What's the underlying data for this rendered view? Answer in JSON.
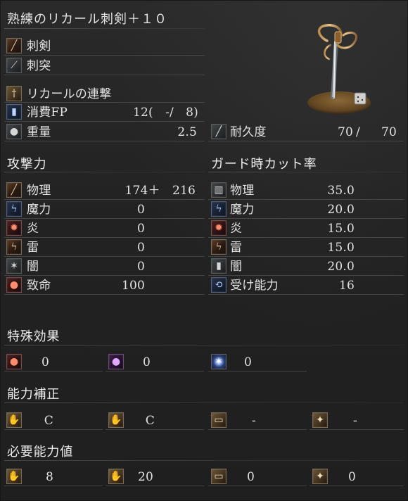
{
  "weapon": {
    "name": "熟練のリカール刺剣＋１０",
    "image_icon": "rapier-with-pedestal-icon",
    "attack_types": [
      {
        "icon": "slash-type-icon",
        "label": "刺剣"
      },
      {
        "icon": "thrust-type-icon",
        "label": "刺突"
      }
    ],
    "skill": {
      "icon": "skill-icon",
      "label": "リカールの連撃"
    },
    "fp": {
      "icon": "fp-icon",
      "label": "消費FP",
      "value": "12(　-/　8)"
    },
    "weight": {
      "icon": "weight-icon",
      "label": "重量",
      "value": "2.5"
    },
    "durability": {
      "icon": "durability-icon",
      "label": "耐久度",
      "current": "70",
      "sep": "/",
      "max": "70"
    }
  },
  "attack_power": {
    "title": "攻撃力",
    "rows": [
      {
        "icon": "physical-attack-icon",
        "label": "物理",
        "value": "174＋　216"
      },
      {
        "icon": "magic-attack-icon",
        "label": "魔力",
        "value": "0"
      },
      {
        "icon": "fire-attack-icon",
        "label": "炎",
        "value": "0"
      },
      {
        "icon": "lightning-attack-icon",
        "label": "雷",
        "value": "0"
      },
      {
        "icon": "dark-attack-icon",
        "label": "闇",
        "value": "0"
      },
      {
        "icon": "critical-icon",
        "label": "致命",
        "value": "100"
      }
    ]
  },
  "guard": {
    "title": "ガード時カット率",
    "rows": [
      {
        "icon": "physical-guard-icon",
        "label": "物理",
        "value": "35.0"
      },
      {
        "icon": "magic-guard-icon",
        "label": "魔力",
        "value": "20.0"
      },
      {
        "icon": "fire-guard-icon",
        "label": "炎",
        "value": "15.0"
      },
      {
        "icon": "lightning-guard-icon",
        "label": "雷",
        "value": "15.0"
      },
      {
        "icon": "dark-guard-icon",
        "label": "闇",
        "value": "20.0"
      },
      {
        "icon": "stability-icon",
        "label": "受け能力",
        "value": "16"
      }
    ]
  },
  "special_effects": {
    "title": "特殊効果",
    "items": [
      {
        "icon": "bleed-effect-icon",
        "value": "0"
      },
      {
        "icon": "poison-effect-icon",
        "value": "0"
      },
      {
        "icon": "frost-effect-icon",
        "value": "0"
      }
    ]
  },
  "scaling": {
    "title": "能力補正",
    "items": [
      {
        "icon": "strength-scaling-icon",
        "value": "C"
      },
      {
        "icon": "dexterity-scaling-icon",
        "value": "C"
      },
      {
        "icon": "intelligence-scaling-icon",
        "value": "-"
      },
      {
        "icon": "faith-scaling-icon",
        "value": "-"
      }
    ]
  },
  "requirements": {
    "title": "必要能力値",
    "items": [
      {
        "icon": "strength-requirement-icon",
        "value": "8"
      },
      {
        "icon": "dexterity-requirement-icon",
        "value": "20"
      },
      {
        "icon": "intelligence-requirement-icon",
        "value": "0"
      },
      {
        "icon": "faith-requirement-icon",
        "value": "0"
      }
    ]
  }
}
